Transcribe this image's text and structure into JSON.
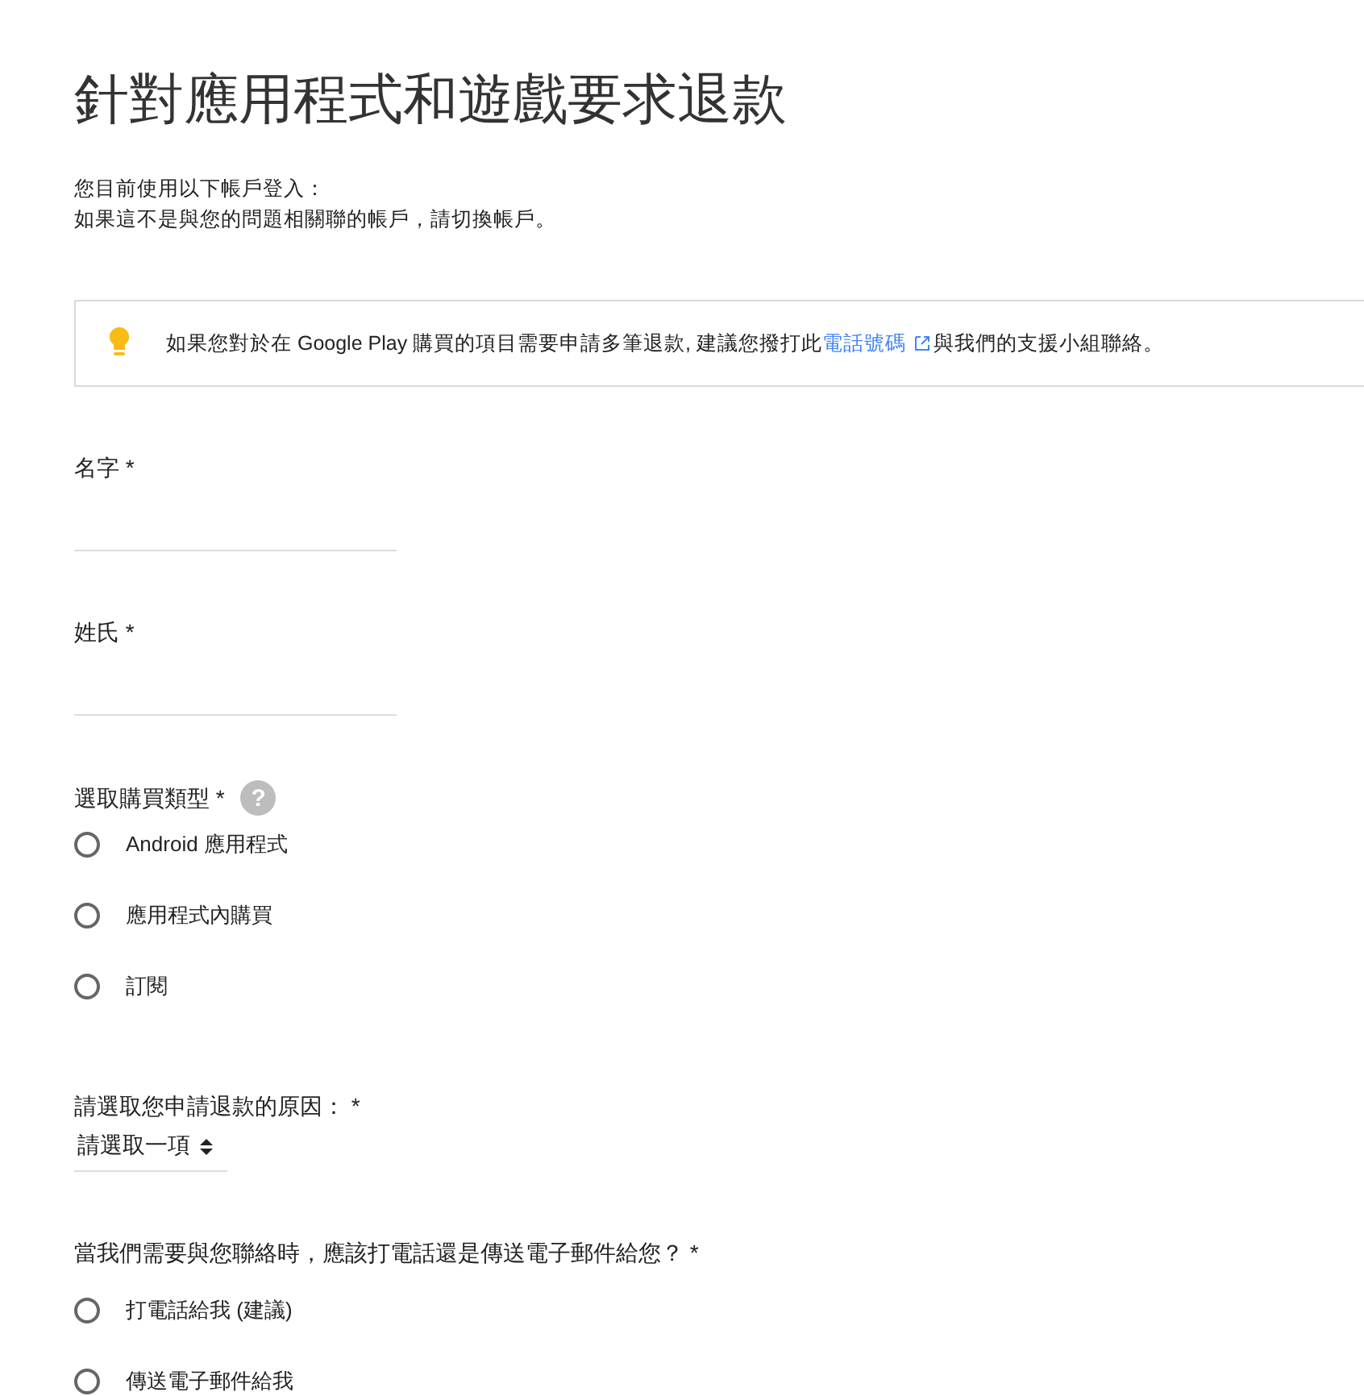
{
  "title": "針對應用程式和遊戲要求退款",
  "account_lines": [
    "您目前使用以下帳戶登入：",
    "如果這不是與您的問題相關聯的帳戶，請切換帳戶。"
  ],
  "notice": {
    "text_before": "如果您對於在 Google Play 購買的項目需要申請多筆退款, 建議您撥打此",
    "link": "電話號碼",
    "text_after": "與我們的支援小組聯絡。"
  },
  "fields": [
    {
      "label": "名字 *"
    },
    {
      "label": "姓氏 *"
    }
  ],
  "purchase_type": {
    "label": "選取購買類型 *",
    "help": "?",
    "options": [
      {
        "label": "Android 應用程式",
        "selected": false
      },
      {
        "label": "應用程式內購買",
        "selected": false
      },
      {
        "label": "訂閱",
        "selected": false
      }
    ]
  },
  "reason": {
    "label": "請選取您申請退款的原因： *",
    "value": "請選取一項"
  },
  "contact": {
    "label": "當我們需要與您聯絡時，應該打電話還是傳送電子郵件給您？ *",
    "options": [
      {
        "label": "打電話給我 (建議)",
        "selected": false
      },
      {
        "label": "傳送電子郵件給我",
        "selected": false
      }
    ]
  }
}
